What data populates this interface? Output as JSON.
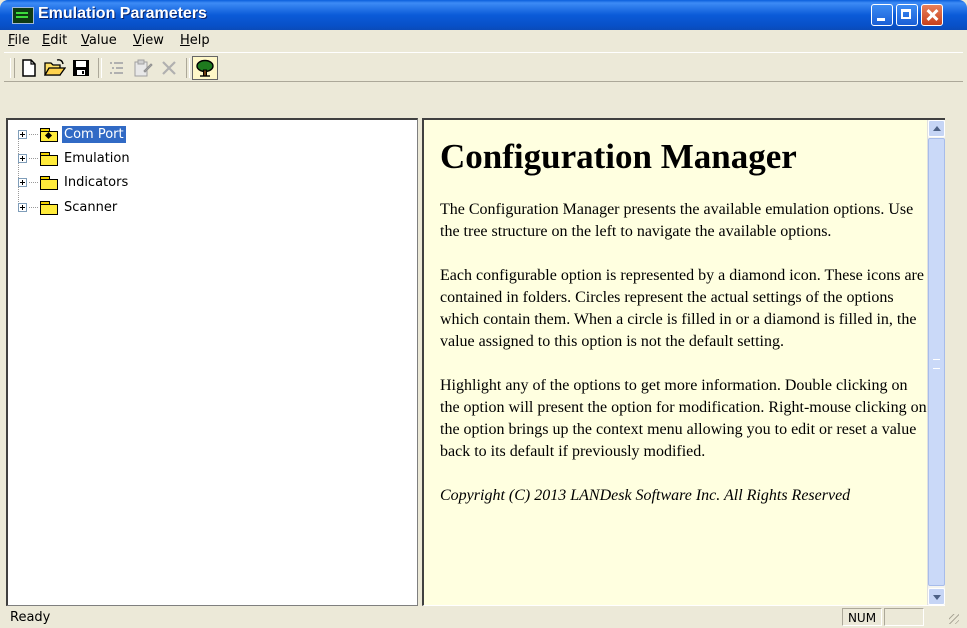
{
  "window": {
    "title": "Emulation Parameters",
    "icon": "terminal-icon",
    "controls": [
      "minimize-icon",
      "maximize-icon",
      "close-icon"
    ]
  },
  "menu": [
    {
      "underline": "F",
      "rest": "ile"
    },
    {
      "underline": "E",
      "rest": "dit"
    },
    {
      "underline": "V",
      "rest": "alue"
    },
    {
      "underline": "V",
      "rest": "iew"
    },
    {
      "underline": "H",
      "rest": "elp"
    }
  ],
  "toolbar": {
    "tools": [
      "new-document-icon",
      "open-folder-icon",
      "save-icon",
      "list-icon",
      "properties-icon",
      "delete-icon",
      "tree-icon"
    ]
  },
  "tree": {
    "nodes": [
      {
        "label": "Com Port",
        "selected": true
      },
      {
        "label": "Emulation",
        "selected": false
      },
      {
        "label": "Indicators",
        "selected": false
      },
      {
        "label": "Scanner",
        "selected": false
      }
    ]
  },
  "doc": {
    "heading": "Configuration Manager",
    "p1": "The Configuration Manager presents the available emulation options.  Use the tree structure on the left to navigate the available options.",
    "p2": "Each configurable option is represented by a diamond icon. These icons are contained in folders.  Circles represent the actual settings of the options which contain them.  When a circle is filled in or a diamond is filled in, the value assigned to this option is not the default setting.",
    "p3": "Highlight any of the options to get more information. Double clicking on the option will present the option for modification. Right-mouse clicking on the option brings up the context menu allowing you to edit or reset a value back to its default if previously modified.",
    "copyright": "Copyright (C) 2013 LANDesk Software Inc.  All Rights Reserved"
  },
  "status": {
    "text": "Ready",
    "num": "NUM"
  },
  "colors": {
    "titlebar": "#0b5bd8",
    "selection": "#316ac5",
    "doc_background": "#ffffe0",
    "folder": "#ffeb3b"
  }
}
